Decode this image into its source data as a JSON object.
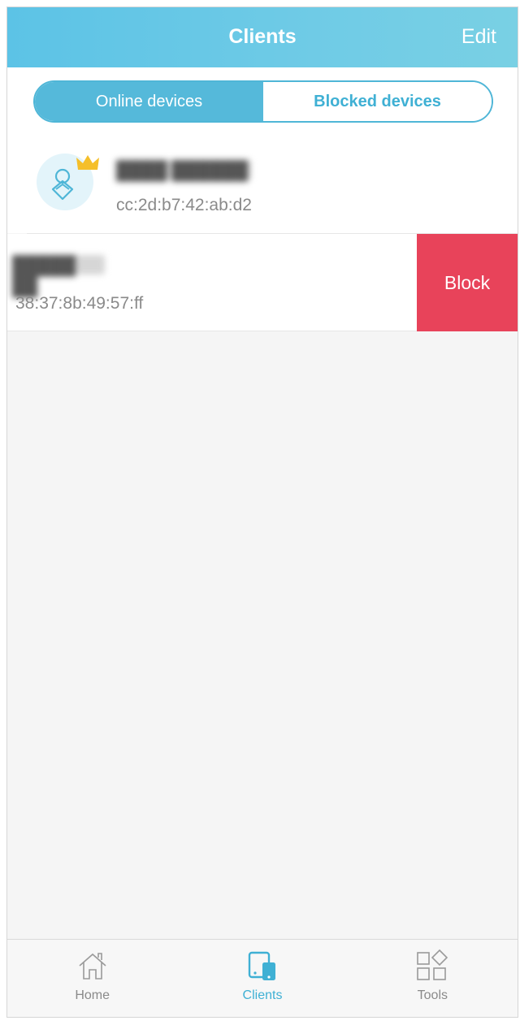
{
  "header": {
    "title": "Clients",
    "edit_label": "Edit"
  },
  "segments": {
    "online_label": "Online devices",
    "blocked_label": "Blocked devices",
    "active": "online"
  },
  "clients": [
    {
      "name": "████ ██████",
      "mac": "cc:2d:b7:42:ab:d2",
      "owner": true
    },
    {
      "name": "█████ ██",
      "mac": "38:37:8b:49:57:ff",
      "action_label": "Block"
    }
  ],
  "tabbar": {
    "items": [
      {
        "label": "Home",
        "icon": "home-icon"
      },
      {
        "label": "Clients",
        "icon": "devices-icon",
        "active": true
      },
      {
        "label": "Tools",
        "icon": "tools-icon"
      }
    ]
  },
  "colors": {
    "header_start": "#5cc3e6",
    "accent": "#55b9da",
    "block": "#e8435a",
    "crown": "#f5bf2a"
  }
}
